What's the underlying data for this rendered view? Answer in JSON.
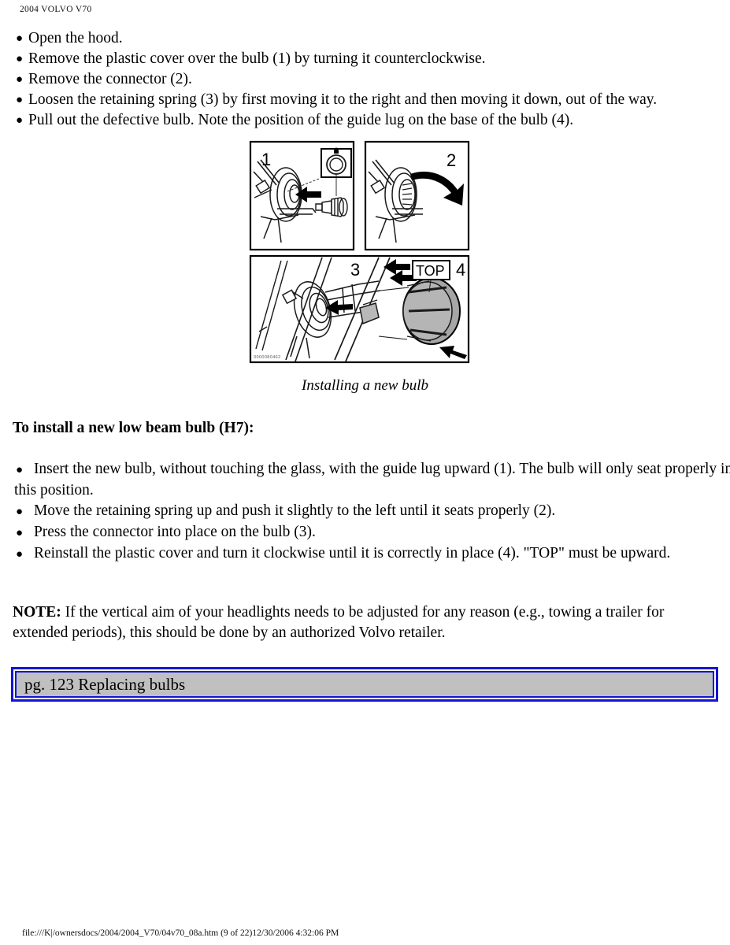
{
  "header": {
    "title": "2004 VOLVO V70"
  },
  "removal_steps": {
    "bullet_glyph": "●",
    "items": [
      "Open the hood.",
      "Remove the plastic cover over the bulb (1) by turning it counterclockwise.",
      "Remove the connector (2).",
      "Loosen the retaining spring (3) by first moving it to the right and then moving it down, out of the way.",
      "Pull out the defective bulb. Note the position of the guide lug on the base of the bulb (4)."
    ]
  },
  "figure": {
    "caption": "Installing a new bulb",
    "panel_labels": [
      "1",
      "2",
      "3",
      "4"
    ],
    "top_marker_label": "TOP",
    "illustration_code": "3000080462"
  },
  "install_section": {
    "heading": "To install a new low beam bulb (H7):",
    "bullet_glyph": "●",
    "items": [
      "Insert the new bulb, without touching the glass, with the guide lug upward (1). The bulb will only seat properly in this position.",
      "Move the retaining spring up and push it slightly to the left until it seats properly (2).",
      "Press the connector into place on the bulb (3).",
      "Reinstall the plastic cover and turn it clockwise until it is correctly in place (4). \"TOP\" must be upward."
    ]
  },
  "note": {
    "label": "NOTE:",
    "text": " If the vertical aim of your headlights needs to be adjusted for any reason (e.g., towing a trailer for extended periods), this should be done by an authorized Volvo retailer."
  },
  "page_reference": {
    "text": "pg. 123 Replacing bulbs",
    "border_color": "#1414d2",
    "fill_color": "#c0c0c0"
  },
  "footer": {
    "text": "file:///K|/ownersdocs/2004/2004_V70/04v70_08a.htm (9 of 22)12/30/2006 4:32:06 PM"
  }
}
